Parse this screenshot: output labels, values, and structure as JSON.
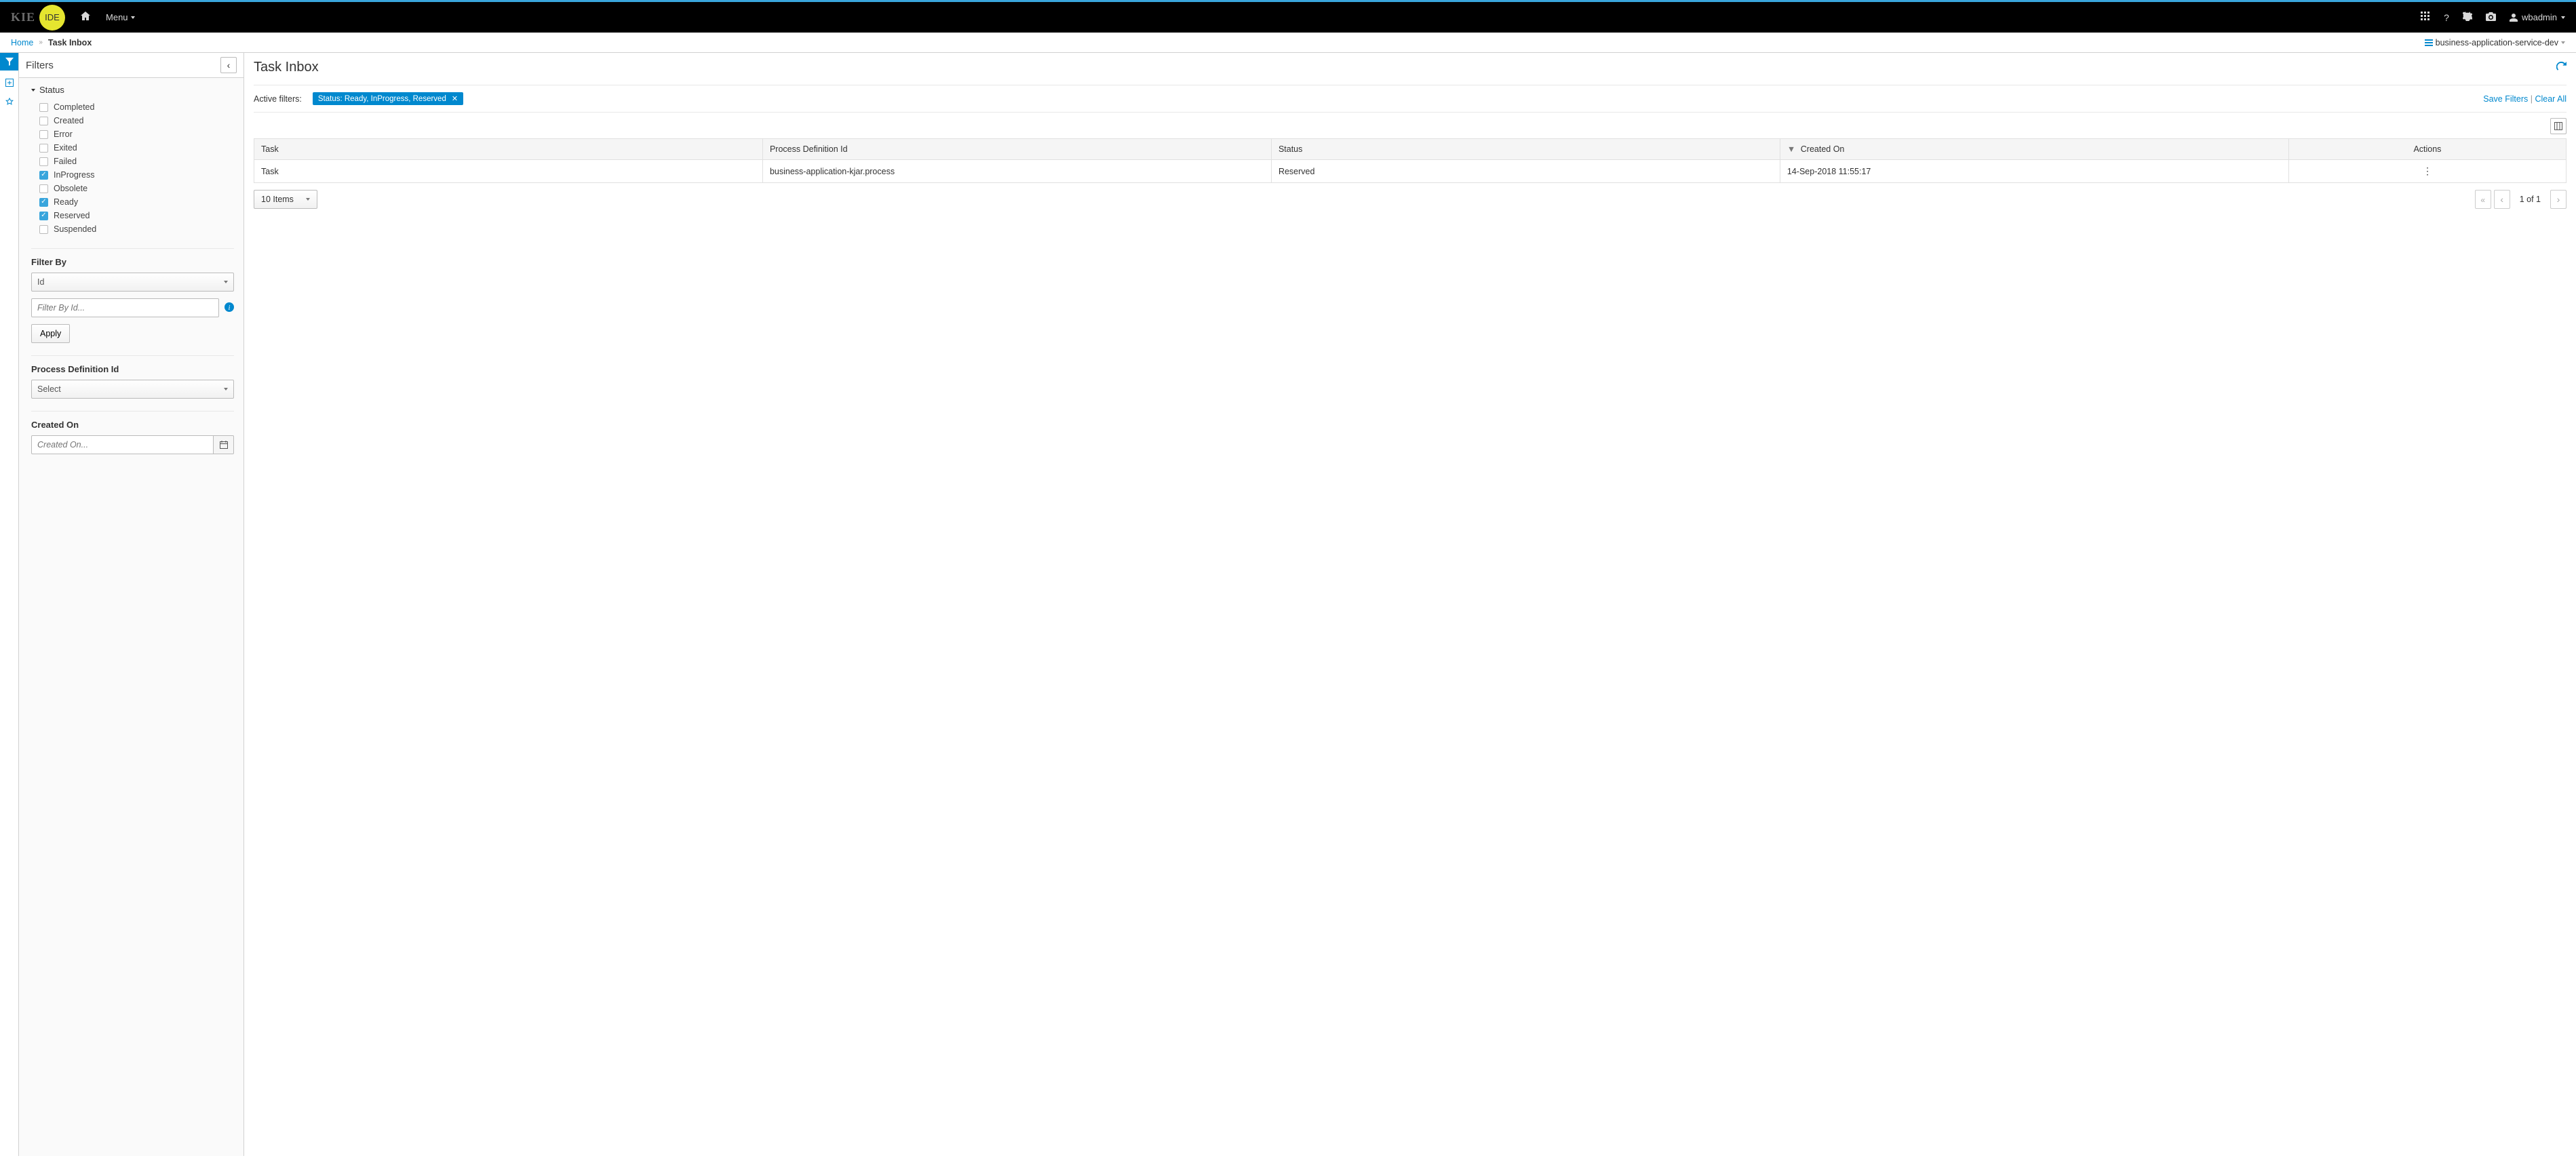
{
  "topbar": {
    "logo_left": "KIE",
    "logo_right": "IDE",
    "menu_label": "Menu",
    "user": "wbadmin"
  },
  "breadcrumb": {
    "home": "Home",
    "current": "Task Inbox",
    "server": "business-application-service-dev"
  },
  "filters": {
    "title": "Filters",
    "status_label": "Status",
    "statuses": [
      {
        "label": "Completed",
        "checked": false
      },
      {
        "label": "Created",
        "checked": false
      },
      {
        "label": "Error",
        "checked": false
      },
      {
        "label": "Exited",
        "checked": false
      },
      {
        "label": "Failed",
        "checked": false
      },
      {
        "label": "InProgress",
        "checked": true
      },
      {
        "label": "Obsolete",
        "checked": false
      },
      {
        "label": "Ready",
        "checked": true
      },
      {
        "label": "Reserved",
        "checked": true
      },
      {
        "label": "Suspended",
        "checked": false
      }
    ],
    "filter_by_label": "Filter By",
    "filter_by_value": "Id",
    "filter_by_placeholder": "Filter By Id...",
    "apply_label": "Apply",
    "pdi_label": "Process Definition Id",
    "pdi_value": "Select",
    "created_on_label": "Created On",
    "created_on_placeholder": "Created On..."
  },
  "content": {
    "title": "Task Inbox",
    "active_filters_label": "Active filters:",
    "active_chip": "Status: Ready, InProgress, Reserved",
    "save_filters": "Save Filters",
    "clear_all": "Clear All",
    "columns": {
      "task": "Task",
      "pdi": "Process Definition Id",
      "status": "Status",
      "created": "Created On",
      "actions": "Actions"
    },
    "rows": [
      {
        "task": "Task",
        "pdi": "business-application-kjar.process",
        "status": "Reserved",
        "created": "14-Sep-2018 11:55:17"
      }
    ],
    "items_label": "10 Items",
    "page_info": "1 of 1"
  }
}
